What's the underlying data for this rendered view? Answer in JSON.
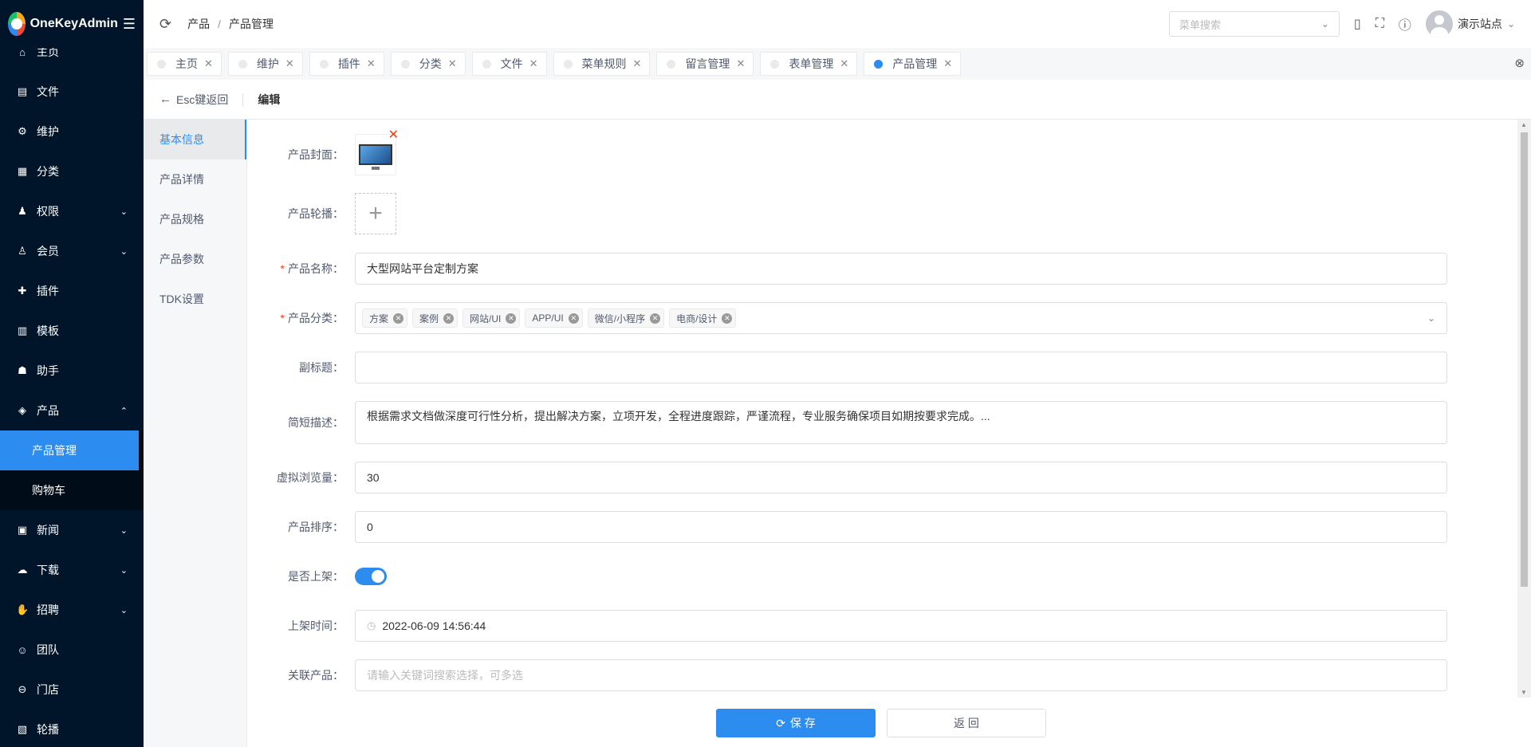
{
  "app": {
    "name": "OneKeyAdmin"
  },
  "sidebar": {
    "items": [
      {
        "label": "主页",
        "icon": "home-icon",
        "arrow": ""
      },
      {
        "label": "文件",
        "icon": "file-icon",
        "arrow": ""
      },
      {
        "label": "维护",
        "icon": "gear-icon",
        "arrow": ""
      },
      {
        "label": "分类",
        "icon": "grid-icon",
        "arrow": ""
      },
      {
        "label": "权限",
        "icon": "user-lock-icon",
        "arrow": "⌄"
      },
      {
        "label": "会员",
        "icon": "user-icon",
        "arrow": "⌄"
      },
      {
        "label": "插件",
        "icon": "plugin-icon",
        "arrow": ""
      },
      {
        "label": "模板",
        "icon": "template-icon",
        "arrow": ""
      },
      {
        "label": "助手",
        "icon": "robot-icon",
        "arrow": ""
      },
      {
        "label": "产品",
        "icon": "box-icon",
        "arrow": "⌃"
      }
    ],
    "submenu": [
      {
        "label": "产品管理"
      },
      {
        "label": "购物车"
      }
    ],
    "items_after": [
      {
        "label": "新闻",
        "icon": "news-icon",
        "arrow": "⌄"
      },
      {
        "label": "下载",
        "icon": "download-icon",
        "arrow": "⌄"
      },
      {
        "label": "招聘",
        "icon": "handshake-icon",
        "arrow": "⌄"
      },
      {
        "label": "团队",
        "icon": "team-icon",
        "arrow": ""
      },
      {
        "label": "门店",
        "icon": "store-icon",
        "arrow": ""
      },
      {
        "label": "轮播",
        "icon": "carousel-icon",
        "arrow": ""
      }
    ]
  },
  "header": {
    "breadcrumb": [
      "产品",
      "产品管理"
    ],
    "menu_search_placeholder": "菜单搜索",
    "user_name": "演示站点"
  },
  "tabs": [
    {
      "label": "主页"
    },
    {
      "label": "维护"
    },
    {
      "label": "插件"
    },
    {
      "label": "分类"
    },
    {
      "label": "文件"
    },
    {
      "label": "菜单规则"
    },
    {
      "label": "留言管理"
    },
    {
      "label": "表单管理"
    },
    {
      "label": "产品管理",
      "active": true
    }
  ],
  "page": {
    "back_label": "Esc键返回",
    "title": "编辑"
  },
  "form_nav": [
    "基本信息",
    "产品详情",
    "产品规格",
    "产品参数",
    "TDK设置"
  ],
  "form": {
    "cover_label": "产品封面：",
    "carousel_label": "产品轮播：",
    "name_label": "产品名称：",
    "name_value": "大型网站平台定制方案",
    "category_label": "产品分类：",
    "categories": [
      "方案",
      "案例",
      "网站/UI",
      "APP/UI",
      "微信/小程序",
      "电商/设计"
    ],
    "subtitle_label": "副标题：",
    "subtitle_value": "",
    "desc_label": "简短描述：",
    "desc_value": "根据需求文档做深度可行性分析，提出解决方案，立项开发，全程进度跟踪，严谨流程，专业服务确保项目如期按要求完成。...",
    "views_label": "虚拟浏览量：",
    "views_value": "30",
    "sort_label": "产品排序：",
    "sort_value": "0",
    "onsale_label": "是否上架：",
    "onsale_value": true,
    "time_label": "上架时间：",
    "time_value": "2022-06-09 14:56:44",
    "related_label": "关联产品：",
    "related_placeholder": "请输入关键词搜索选择，可多选"
  },
  "buttons": {
    "save": "保 存",
    "back": "返 回"
  }
}
